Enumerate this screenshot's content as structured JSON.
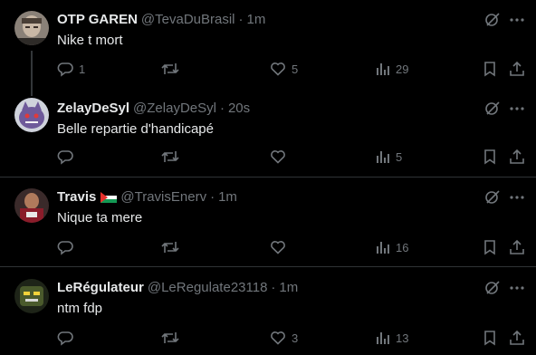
{
  "tweets": [
    {
      "name": "OTP GAREN",
      "handle": "@TevaDuBrasil",
      "time": "1m",
      "text": "Nike t mort",
      "replies": "1",
      "retweets": "",
      "likes": "5",
      "views": "29",
      "avatar_color": "#6b6258"
    },
    {
      "name": "ZelayDeSyl",
      "handle": "@ZelayDeSyl",
      "time": "20s",
      "text": "Belle repartie d'handicapé",
      "replies": "",
      "retweets": "",
      "likes": "",
      "views": "5",
      "avatar_color": "#5a4d7a"
    },
    {
      "name": "Travis",
      "handle": "@TravisEnerv",
      "time": "1m",
      "text": "Nique ta mere",
      "replies": "",
      "retweets": "",
      "likes": "",
      "views": "16",
      "avatar_color": "#7a3a3a"
    },
    {
      "name": "LeRégulateur",
      "handle": "@LeRegulate23118",
      "time": "1m",
      "text": "ntm fdp",
      "replies": "",
      "retweets": "",
      "likes": "3",
      "views": "13",
      "avatar_color": "#3c4a2e"
    }
  ],
  "separator": "·",
  "colors": {
    "background": "#000000",
    "text": "#e7e9ea",
    "muted": "#71767b",
    "divider": "#2f3336"
  },
  "icons": [
    "reply-icon",
    "retweet-icon",
    "like-icon",
    "views-icon",
    "bookmark-icon",
    "share-icon",
    "grok-icon",
    "more-icon"
  ]
}
